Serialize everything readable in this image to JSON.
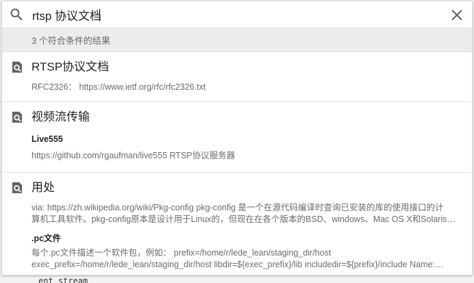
{
  "search": {
    "query": "rtsp 协议文档",
    "search_icon": "search-icon",
    "clear_icon": "close-icon"
  },
  "results_count": "3 个符合条件的结果",
  "results": [
    {
      "title": "RTSP协议文档",
      "icon": "doc-search-icon",
      "entries": [
        {
          "snippet": "RFC2326： https://www.ietf.org/rfc/rfc2326.txt"
        }
      ]
    },
    {
      "title": "视频流传输",
      "icon": "doc-search-icon",
      "entries": [
        {
          "subtitle": "Live555",
          "snippet": "https://github.com/rgaufman/live555 RTSP协议服务器"
        }
      ]
    },
    {
      "title": "用处",
      "icon": "doc-search-icon",
      "entries": [
        {
          "snippet_line1": "via: https://zh.wikipedia.org/wiki/Pkg-config pkg-config 是一个在源代码编译时查询已安装的库的使用接口的计",
          "snippet_line2": "算机工具软件。pkg-config原本是设计用于Linux的，但现在在各个版本的BSD、windows、Mac OS X和Solaris…"
        },
        {
          "subtitle": ".pc文件",
          "snippet_line1": "每个.pc文件描述一个软件包，例如： prefix=/home/r/lede_lean/staging_dir/host",
          "snippet_line2": "exec_prefix=/home/r/lede_lean/staging_dir/host libdir=${exec_prefix}/lib includedir=${prefix}/include Name:…"
        }
      ]
    }
  ],
  "background": {
    "bottom_text": "ent_stream"
  },
  "colors": {
    "icon": "#5f6368",
    "text": "#222222",
    "muted": "#6b6b6b",
    "count_bg": "#ececec"
  }
}
